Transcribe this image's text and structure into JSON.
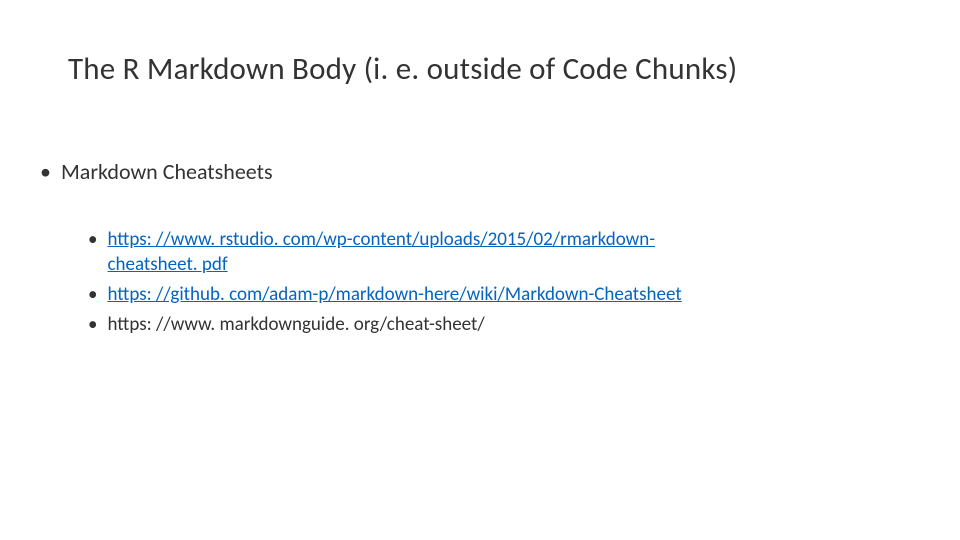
{
  "slide": {
    "title": "The R Markdown Body (i. e. outside of Code Chunks)",
    "section_heading": "Markdown Cheatsheets",
    "links": [
      {
        "text_line1": "https: //www. rstudio. com/wp-content/uploads/2015/02/rmarkdown-",
        "text_line2": "cheatsheet. pdf",
        "is_link": true
      },
      {
        "text_line1": "https: //github. com/adam-p/markdown-here/wiki/Markdown-Cheatsheet",
        "text_line2": "",
        "is_link": true
      },
      {
        "text_line1": "https: //www. markdownguide. org/cheat-sheet/",
        "text_line2": "",
        "is_link": false
      }
    ]
  }
}
